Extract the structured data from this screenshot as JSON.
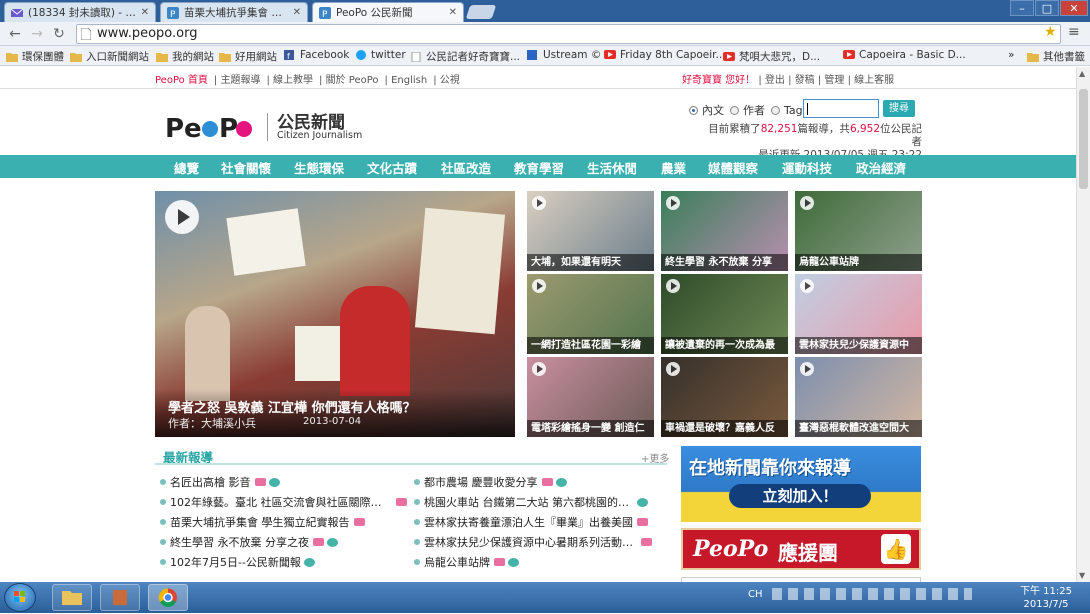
{
  "browser": {
    "tabs": [
      {
        "label": "(18334 封未讀取) - tchan",
        "icon": "mail-icon"
      },
      {
        "label": "苗栗大埔抗爭集會 學生獨",
        "icon": "peopo-icon"
      },
      {
        "label": "PeoPo 公民新聞",
        "icon": "peopo-icon",
        "active": true
      }
    ],
    "url": "www.peopo.org",
    "bookmarks": [
      "環保團體",
      "入口新聞網站",
      "我的網站",
      "好用網站",
      "Facebook",
      "twitter",
      "公民記者好奇寶寶...",
      "Ustream ©",
      "Friday 8th Capoeir...",
      "梵唄大悲咒，D...",
      "Capoeira - Basic D...",
      "»",
      "其他書籤"
    ]
  },
  "site": {
    "toplinks": {
      "home": "PeoPo 首頁",
      "items": [
        "主題報導",
        "線上教學",
        "關於 PeoPo",
        "English",
        "公視"
      ]
    },
    "user": {
      "greeting": "好奇寶寶 您好！",
      "items": [
        "登出",
        "發稿",
        "管理",
        "線上客服"
      ]
    },
    "logo": {
      "text": "PeoPo",
      "cn": "公民新聞",
      "en": "Citizen Journalism"
    },
    "search": {
      "options": [
        "內文",
        "作者",
        "Tag"
      ],
      "selected": "內文",
      "button": "搜尋"
    },
    "stats": {
      "line1a": "目前累積了",
      "reports": "82,251",
      "line1b": "篇報導，共",
      "journalists": "6,952",
      "line1c": "位公民記者",
      "line2": "最近更新 2013/07/05 週五 23:22"
    },
    "nav": [
      "總覽",
      "社會關懷",
      "生態環保",
      "文化古蹟",
      "社區改造",
      "教育學習",
      "生活休閒",
      "農業",
      "媒體觀察",
      "運動科技",
      "政治經濟"
    ],
    "hero": {
      "title": "學者之怒 吳敦義 江宜樺 你們還有人格嗎？",
      "author": "作者：大埔溪小兵",
      "date": "2013-07-04"
    },
    "thumbs": [
      "大埔，如果還有明天",
      "終生學習 永不放棄 分享",
      "烏龍公車站牌",
      "一網打造社區花園一彩繪",
      "讓被遺棄的再一次成為最",
      "雲林家扶兒少保護資源中",
      "電塔彩繪搖身一變 創造仁",
      "車禍還是破壞？嘉義人反",
      "臺灣惡棍軟體改進空間大"
    ],
    "latest": {
      "heading": "最新報導",
      "more": "+更多",
      "left": [
        "名匠出高檜 影音",
        "102年綠藝。臺北 社區交流會與社區關際…",
        "苗栗大埔抗爭集會 學生獨立紀實報告",
        "終生學習 永不放棄 分享之夜",
        "102年7月5日--公民新聞報"
      ],
      "right": [
        "都市農場 慶豐收愛分享",
        "桃園火車站 台鐵第二大站 第六都桃園的…",
        "雲林家扶寄養童漂泊人生『畢業』出養美國",
        "雲林家扶兒少保護資源中心暑期系列活動…",
        "烏龍公車站牌"
      ]
    },
    "banner1": {
      "line1": "在地新聞靠你來報導",
      "line2": "立刻加入！"
    },
    "banner2": {
      "logo": "PeoPo",
      "text": "應援團"
    }
  },
  "taskbar": {
    "tray": "CH",
    "time": "下午 11:25",
    "date": "2013/7/5"
  },
  "colors": {
    "accent": "#3bb0b0",
    "red": "#dd1144",
    "taskbar": "#2a5e99"
  }
}
